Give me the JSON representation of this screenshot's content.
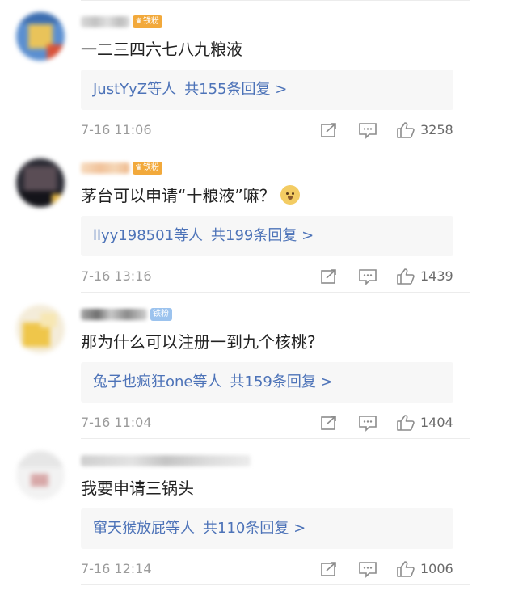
{
  "comments": [
    {
      "badge": "铁粉",
      "text": "一二三四六七八九粮液",
      "reply": {
        "users": "JustYyZ",
        "suffix": "等人",
        "total": "共155条回复 >"
      },
      "time": "7-16 11:06",
      "likes": "3258"
    },
    {
      "badge": "铁粉",
      "text": "茅台可以申请“十粮液”嘛？",
      "reply": {
        "users": "llyy198501",
        "suffix": "等人",
        "total": "共199条回复 >"
      },
      "time": "7-16 13:16",
      "likes": "1439"
    },
    {
      "badge": "铁粉",
      "text": "那为什么可以注册一到九个核桃?",
      "reply": {
        "users": "兔子也疯狂one",
        "suffix": "等人",
        "total": "共159条回复 >"
      },
      "time": "7-16 11:04",
      "likes": "1404"
    },
    {
      "text": "我要申请三锅头",
      "reply": {
        "users": "窜天猴放屁",
        "suffix": "等人",
        "total": "共110条回复 >"
      },
      "time": "7-16 12:14",
      "likes": "1006"
    }
  ],
  "colors": {
    "link": "#4d73b8",
    "badge_gold": "#f2a93b",
    "badge_blue": "#9cc3ee",
    "meta_gray": "#9b9b9b"
  },
  "icons": [
    "forward-icon",
    "comment-icon",
    "thumbs-up-icon",
    "doge-emoji-icon",
    "crown-icon"
  ]
}
